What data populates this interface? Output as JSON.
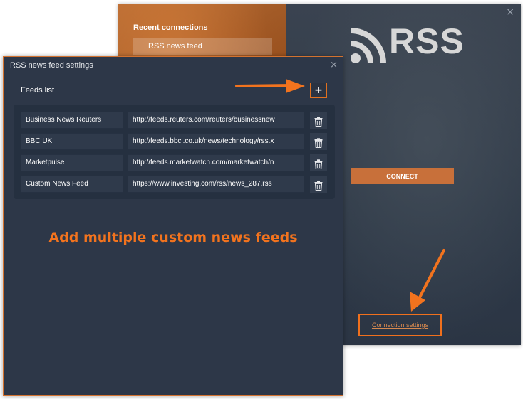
{
  "connect_window": {
    "recent_connections_title": "Recent connections",
    "recent_item": "RSS news feed",
    "logo_text": "RSS",
    "connect_label": "CONNECT",
    "connection_settings_label": "Connection settings",
    "close_symbol": "×"
  },
  "settings_dialog": {
    "title": "RSS news feed settings",
    "close_symbol": "×",
    "feeds_list_label": "Feeds list",
    "add_label": "+",
    "feeds": [
      {
        "name": "Business News Reuters",
        "url": "http://feeds.reuters.com/reuters/businessnew"
      },
      {
        "name": "BBC UK",
        "url": "http://feeds.bbci.co.uk/news/technology/rss.x"
      },
      {
        "name": "Marketpulse",
        "url": "http://feeds.marketwatch.com/marketwatch/n"
      },
      {
        "name": "Custom News Feed",
        "url": "https://www.investing.com/rss/news_287.rss"
      }
    ]
  },
  "annotation": {
    "headline": "Add multiple custom news feeds",
    "accent_color": "#f2731e"
  },
  "icons": [
    "rss-icon",
    "trash-icon",
    "arrow-icon"
  ]
}
